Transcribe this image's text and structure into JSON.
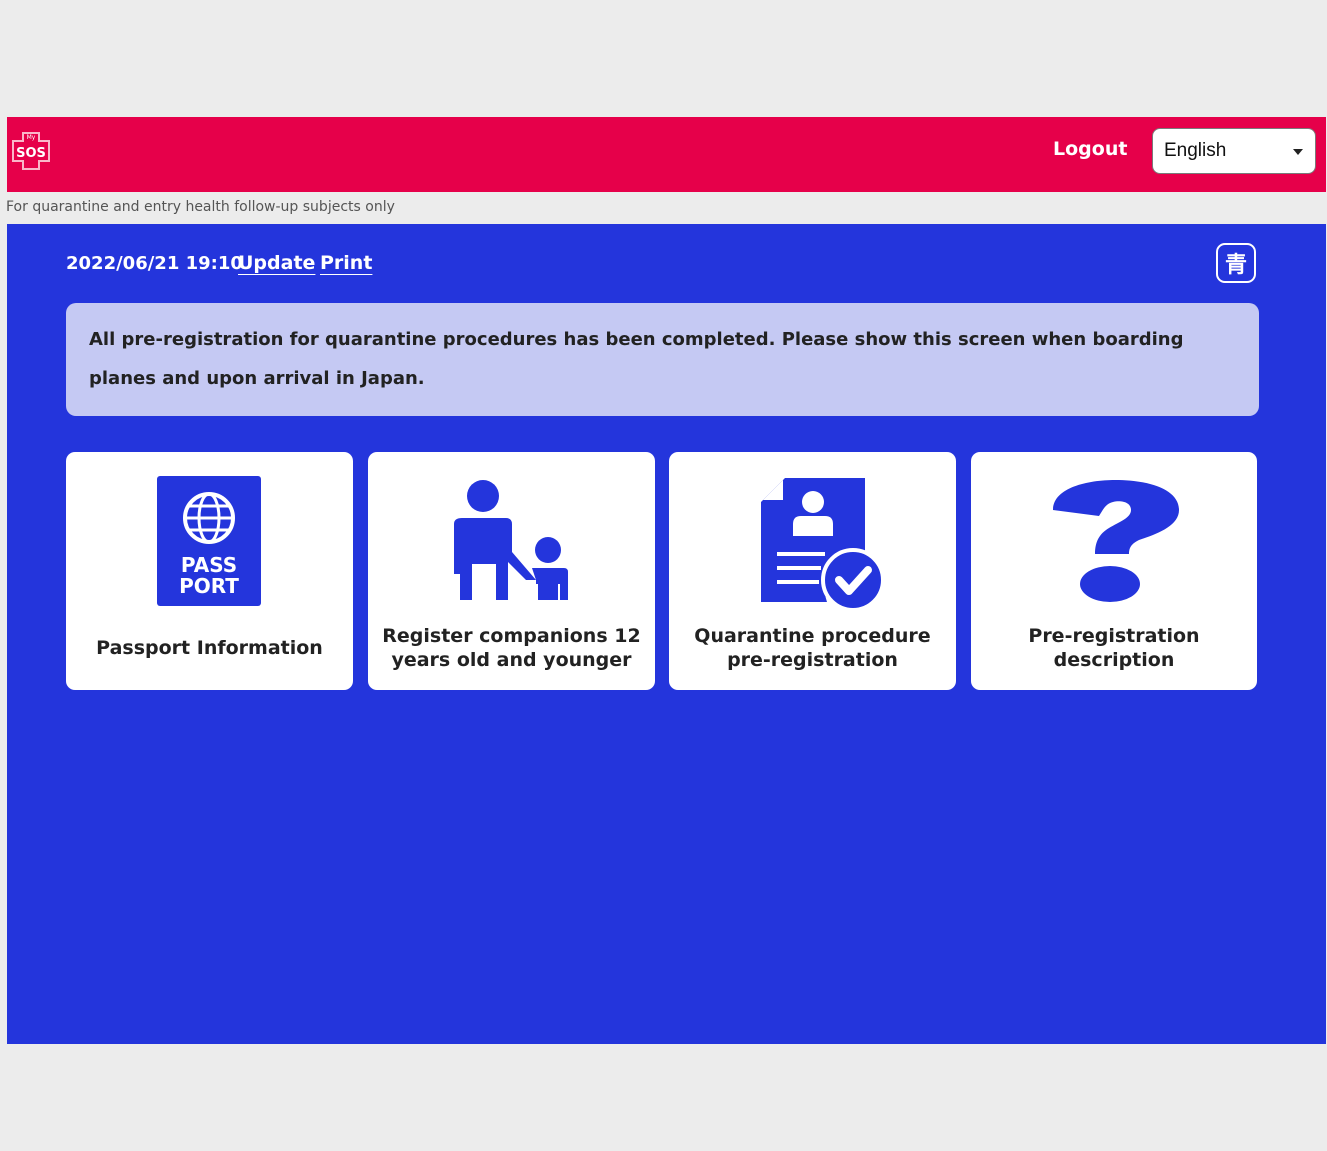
{
  "header": {
    "logo_icon": "mysos-logo-icon",
    "logout_label": "Logout",
    "language": {
      "selected": "English"
    }
  },
  "subbar": {
    "text": "For quarantine and entry health follow-up subjects only"
  },
  "toolbar": {
    "datetime": "2022/06/21 19:10",
    "update_label": "Update",
    "print_label": "Print",
    "color_toggle_label": "青"
  },
  "notice": {
    "text": "All pre-registration for quarantine procedures has been completed. Please show this screen when boarding planes and upon arrival in Japan."
  },
  "cards": [
    {
      "label": "Passport Information",
      "icon": "passport-icon",
      "icon_text_1": "PASS",
      "icon_text_2": "PORT"
    },
    {
      "label": "Register companions 12 years old and younger",
      "icon": "adult-child-icon"
    },
    {
      "label": "Quarantine procedure pre-registration",
      "icon": "document-check-icon"
    },
    {
      "label": "Pre-registration description",
      "icon": "question-mark-icon"
    }
  ],
  "colors": {
    "header_bg": "#e6004a",
    "main_bg": "#2435dc",
    "notice_bg": "#c5c9f3",
    "card_bg": "#ffffff"
  }
}
